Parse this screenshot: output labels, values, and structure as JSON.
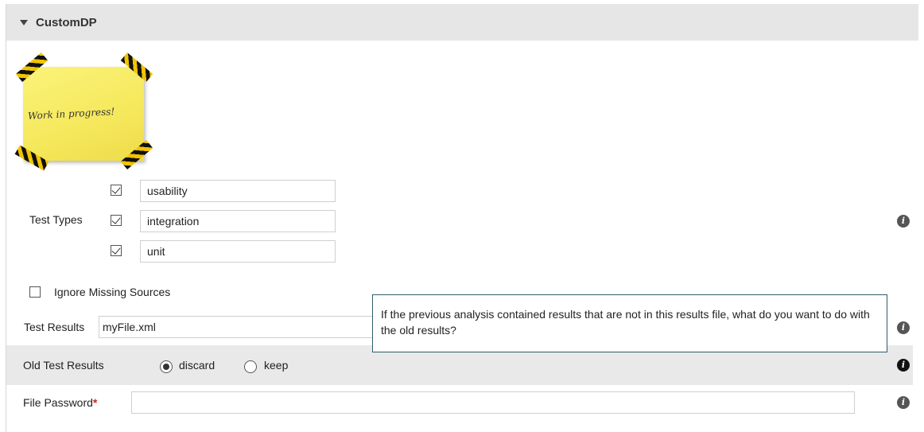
{
  "section": {
    "title": "CustomDP"
  },
  "note": {
    "text": "Work in progress!"
  },
  "test_types": {
    "label": "Test Types",
    "items": [
      {
        "checked": true,
        "value": "usability"
      },
      {
        "checked": true,
        "value": "integration"
      },
      {
        "checked": true,
        "value": "unit"
      }
    ]
  },
  "ignore_missing": {
    "label": "Ignore Missing Sources",
    "checked": false
  },
  "test_results": {
    "label": "Test Results",
    "value": "myFile.xml"
  },
  "old_results": {
    "label": "Old Test Results",
    "options": [
      {
        "label": "discard",
        "selected": true
      },
      {
        "label": "keep",
        "selected": false
      }
    ]
  },
  "file_password": {
    "label": "File Password",
    "required_mark": "*",
    "value": ""
  },
  "tooltip": {
    "text": "If the previous analysis contained results that are not in this results file, what do you want to do with the old results?"
  },
  "icons": {
    "info": "info-icon",
    "section_toggle": "caret-down-icon"
  },
  "colors": {
    "tooltip_border": "#2f5d6a",
    "required": "#c62828",
    "band": "#e9e9e9"
  }
}
